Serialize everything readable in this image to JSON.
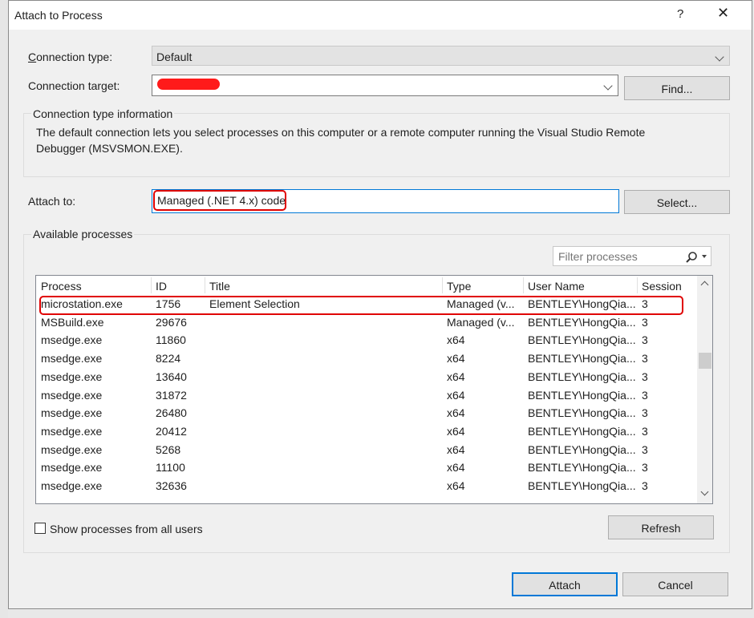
{
  "dialog": {
    "title": "Attach to Process",
    "help": "?",
    "close": "✕"
  },
  "connection": {
    "type_label": "Connection type:",
    "type_value": "Default",
    "target_label": "Connection target:",
    "target_value": "",
    "find_label": "Find..."
  },
  "info": {
    "heading": "Connection type information",
    "text": "The default connection lets you select processes on this computer or a remote computer running the Visual Studio Remote Debugger (MSVSMON.EXE)."
  },
  "attach_to": {
    "label": "Attach to:",
    "value": "Managed (.NET 4.x) code",
    "select_label": "Select..."
  },
  "processes": {
    "heading": "Available processes",
    "filter_placeholder": "Filter processes",
    "columns": [
      "Process",
      "ID",
      "Title",
      "Type",
      "User Name",
      "Session"
    ],
    "rows": [
      [
        "microstation.exe",
        "1756",
        "Element Selection",
        "Managed (v...",
        "BENTLEY\\HongQia...",
        "3"
      ],
      [
        "MSBuild.exe",
        "29676",
        "",
        "Managed (v...",
        "BENTLEY\\HongQia...",
        "3"
      ],
      [
        "msedge.exe",
        "11860",
        "",
        "x64",
        "BENTLEY\\HongQia...",
        "3"
      ],
      [
        "msedge.exe",
        "8224",
        "",
        "x64",
        "BENTLEY\\HongQia...",
        "3"
      ],
      [
        "msedge.exe",
        "13640",
        "",
        "x64",
        "BENTLEY\\HongQia...",
        "3"
      ],
      [
        "msedge.exe",
        "31872",
        "",
        "x64",
        "BENTLEY\\HongQia...",
        "3"
      ],
      [
        "msedge.exe",
        "26480",
        "",
        "x64",
        "BENTLEY\\HongQia...",
        "3"
      ],
      [
        "msedge.exe",
        "20412",
        "",
        "x64",
        "BENTLEY\\HongQia...",
        "3"
      ],
      [
        "msedge.exe",
        "5268",
        "",
        "x64",
        "BENTLEY\\HongQia...",
        "3"
      ],
      [
        "msedge.exe",
        "11100",
        "",
        "x64",
        "BENTLEY\\HongQia...",
        "3"
      ],
      [
        "msedge.exe",
        "32636",
        "",
        "x64",
        "BENTLEY\\HongQia...",
        "3"
      ]
    ],
    "show_all_label": "Show processes from all users",
    "show_all_checked": false,
    "refresh_label": "Refresh"
  },
  "footer": {
    "attach_label": "Attach",
    "cancel_label": "Cancel"
  },
  "colors": {
    "highlight_red": "#e00000",
    "primary_border": "#0078d7"
  }
}
